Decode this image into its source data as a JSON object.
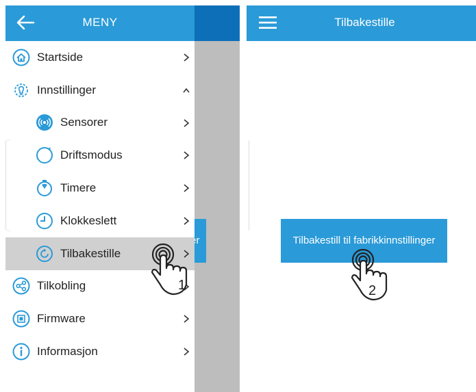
{
  "left_panel": {
    "header": {
      "title": "MENY",
      "back_icon": "arrow-left-icon"
    },
    "behind_button_fragment": "er",
    "menu_items": [
      {
        "label": "Startside",
        "icon": "home-icon",
        "level": "top",
        "chevron": "right"
      },
      {
        "label": "Innstillinger",
        "icon": "settings-bulb-icon",
        "level": "top",
        "chevron": "up"
      },
      {
        "label": "Sensorer",
        "icon": "sensor-icon",
        "level": "sub",
        "chevron": "right"
      },
      {
        "label": "Driftsmodus",
        "icon": "mode-icon",
        "level": "sub",
        "chevron": "right"
      },
      {
        "label": "Timere",
        "icon": "timer-icon",
        "level": "sub",
        "chevron": "right"
      },
      {
        "label": "Klokkeslett",
        "icon": "clock-icon",
        "level": "sub",
        "chevron": "right"
      },
      {
        "label": "Tilbakestille",
        "icon": "reset-icon",
        "level": "sub",
        "chevron": "right",
        "selected": true
      },
      {
        "label": "Tilkobling",
        "icon": "share-icon",
        "level": "top",
        "chevron": "right"
      },
      {
        "label": "Firmware",
        "icon": "firmware-icon",
        "level": "top",
        "chevron": "right"
      },
      {
        "label": "Informasjon",
        "icon": "info-icon",
        "level": "top",
        "chevron": "right"
      }
    ],
    "step_label": "1"
  },
  "right_panel": {
    "header": {
      "title": "Tilbakestille",
      "menu_icon": "hamburger-icon"
    },
    "reset_button_label": "Tilbakestill til fabrikkinnstillinger",
    "step_label": "2"
  },
  "colors": {
    "accent": "#2a9ad8",
    "accent_dark": "#0d6fb8",
    "selected_row": "#d0d0d0",
    "overlay_gray": "#bdbdbd"
  }
}
